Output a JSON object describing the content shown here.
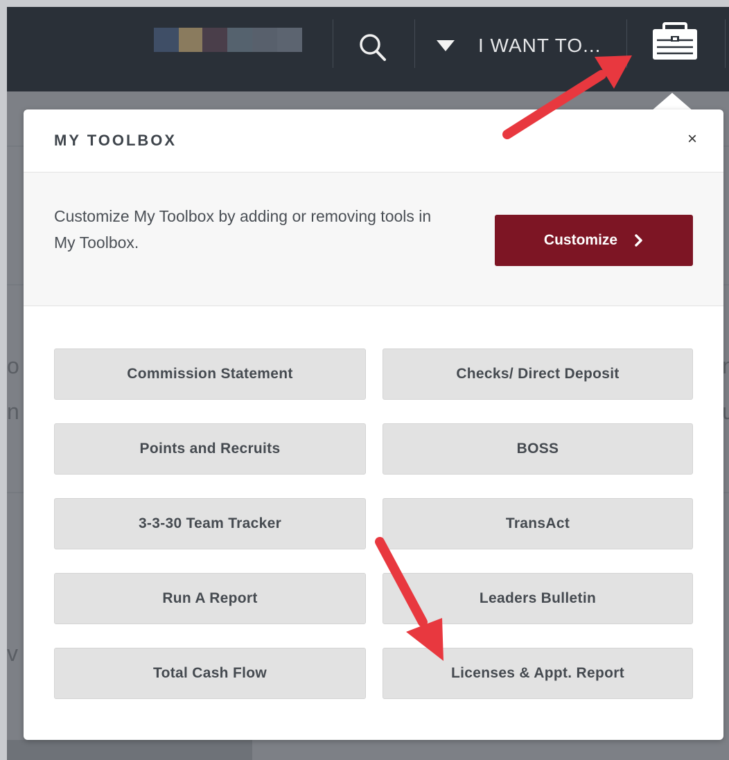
{
  "header": {
    "i_want_to_label": "I WANT TO...",
    "icons": {
      "search": "search-icon",
      "dropdown": "triangle-down-icon",
      "toolbox": "toolbox-icon"
    }
  },
  "toolbox": {
    "title": "MY TOOLBOX",
    "close_label": "×",
    "customize_description": "Customize My Toolbox by adding or removing tools in My Toolbox.",
    "customize_button_label": "Customize",
    "customize_button_icon": "chevron-right-icon",
    "tools": [
      "Commission Statement",
      "Checks/ Direct Deposit",
      "Points and Recruits",
      "BOSS",
      "3-3-30 Team Tracker",
      "TransAct",
      "Run A Report",
      "Leaders Bulletin",
      "Total Cash Flow",
      "Licenses & Appt. Report"
    ]
  },
  "colors": {
    "topbar": "#2a3038",
    "customize_button": "#7d1524",
    "tool_button": "#e2e2e2",
    "annotation_arrow": "#e8383f"
  }
}
